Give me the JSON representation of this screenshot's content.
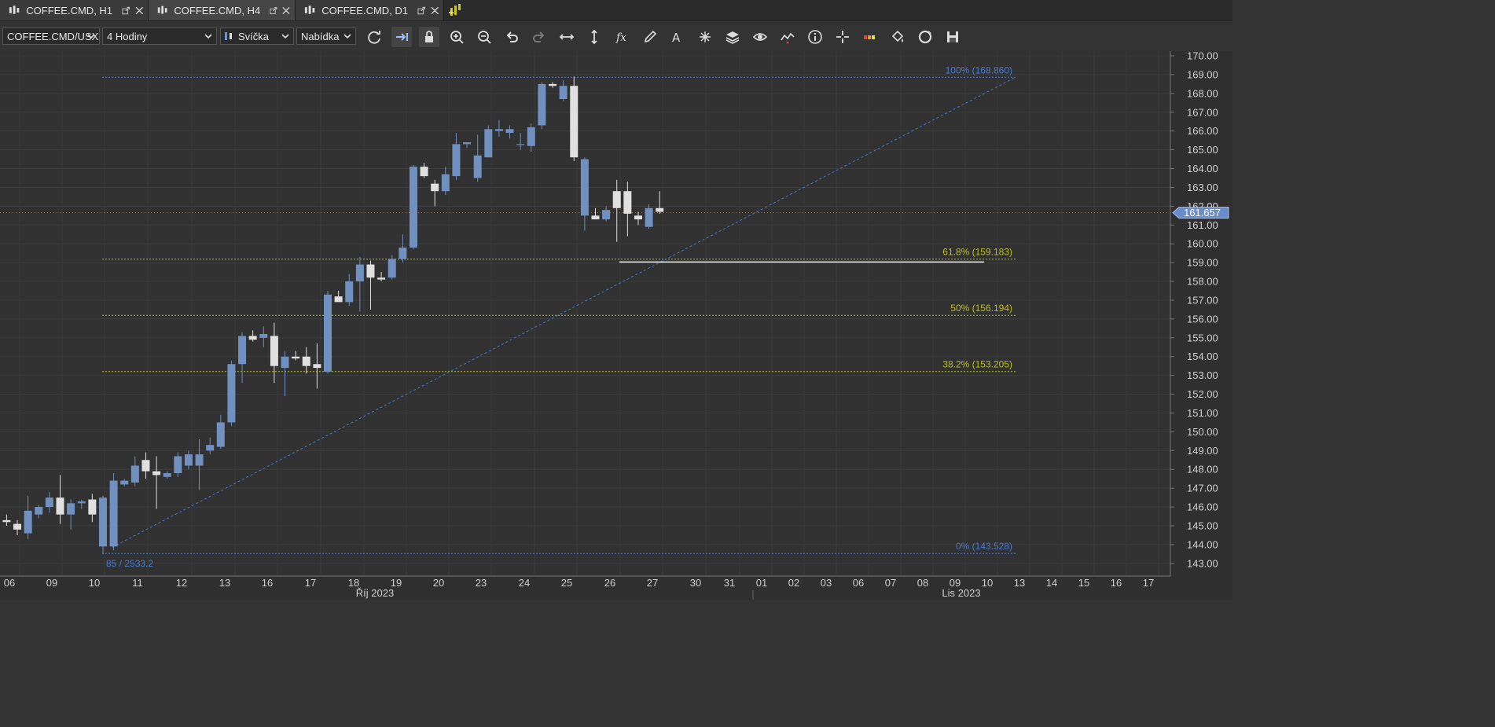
{
  "tabs": [
    {
      "label": "COFFEE.CMD, H1",
      "icon": "candlestick-icon"
    },
    {
      "label": "COFFEE.CMD, H4",
      "icon": "candlestick-icon"
    },
    {
      "label": "COFFEE.CMD, D1",
      "icon": "candlestick-icon"
    }
  ],
  "toolbar": {
    "instrument": "COFFEE.CMD/USX",
    "period": "4 Hodiny",
    "chart_type": "Svíčka",
    "price_side": "Nabídka",
    "icons": [
      "refresh-icon",
      "shift-chart-icon",
      "lock-icon",
      "zoom-in-icon",
      "zoom-out-icon",
      "undo-icon",
      "redo-icon",
      "fit-horizontal-icon",
      "fit-vertical-icon",
      "function-icon",
      "pencil-icon",
      "text-icon",
      "objects-icon",
      "layers-icon",
      "eye-icon",
      "indicator-icon",
      "info-icon",
      "crosshair-icon",
      "color-bar-icon",
      "paint-bucket-icon",
      "template-icon",
      "save-icon"
    ]
  },
  "colors": {
    "bull": "#7090c0",
    "bear": "#e0e0e0",
    "fib_level": "#b8c020",
    "fib_blue": "#4a7ad0",
    "price_tag": "#6a8cc8",
    "background": "#313131"
  },
  "chart_data": {
    "type": "candlestick",
    "ylim": [
      142.5,
      170.25
    ],
    "y_ticks": [
      "170.00",
      "169.00",
      "168.00",
      "167.00",
      "166.00",
      "165.00",
      "164.00",
      "163.00",
      "162.00",
      "161.00",
      "160.00",
      "159.00",
      "158.00",
      "157.00",
      "156.00",
      "155.00",
      "154.00",
      "153.00",
      "152.00",
      "151.00",
      "150.00",
      "149.00",
      "148.00",
      "147.00",
      "146.00",
      "145.00",
      "144.00",
      "143.00"
    ],
    "x_ticks": [
      "06",
      "09",
      "10",
      "11",
      "12",
      "13",
      "16",
      "17",
      "18",
      "19",
      "20",
      "23",
      "24",
      "25",
      "26",
      "27",
      "30",
      "31",
      "01",
      "02",
      "03",
      "06",
      "07",
      "08",
      "09",
      "10",
      "13",
      "14",
      "15",
      "16",
      "17"
    ],
    "month_labels": [
      "Říj 2023",
      "Lis 2023"
    ],
    "current_price": "161.657",
    "fibonacci": [
      {
        "label": "100% (168.860)",
        "value": 168.86
      },
      {
        "label": "61.8% (159.183)",
        "value": 159.183
      },
      {
        "label": "50% (156.194)",
        "value": 156.194
      },
      {
        "label": "38.2% (153.205)",
        "value": 153.205
      },
      {
        "label": "0% (143.528)",
        "value": 143.528
      }
    ],
    "fib_anchor_label": "85 / 2533.2",
    "horizontal_line": 159.03,
    "candles": [
      [
        145.3,
        145.6,
        145.0,
        145.2
      ],
      [
        145.1,
        145.3,
        144.5,
        144.8
      ],
      [
        144.6,
        146.6,
        144.3,
        145.8
      ],
      [
        145.6,
        146.1,
        145.4,
        146.0
      ],
      [
        146.0,
        146.8,
        145.7,
        146.5
      ],
      [
        146.5,
        147.7,
        145.1,
        145.6
      ],
      [
        145.6,
        146.4,
        144.8,
        146.2
      ],
      [
        146.2,
        146.4,
        145.9,
        146.3
      ],
      [
        146.4,
        146.7,
        145.2,
        145.6
      ],
      [
        143.9,
        146.6,
        143.5,
        146.5
      ],
      [
        143.9,
        147.8,
        143.7,
        147.4
      ],
      [
        147.2,
        147.5,
        147.1,
        147.4
      ],
      [
        147.3,
        148.7,
        147.1,
        148.2
      ],
      [
        148.5,
        148.9,
        147.5,
        147.9
      ],
      [
        147.9,
        148.7,
        145.9,
        147.7
      ],
      [
        147.6,
        147.9,
        147.5,
        147.8
      ],
      [
        147.8,
        148.9,
        147.6,
        148.7
      ],
      [
        148.2,
        149.0,
        148.0,
        148.8
      ],
      [
        148.2,
        149.6,
        146.9,
        148.8
      ],
      [
        149.0,
        149.7,
        148.8,
        149.3
      ],
      [
        149.2,
        150.9,
        149.1,
        150.5
      ],
      [
        150.5,
        153.8,
        150.3,
        153.6
      ],
      [
        153.6,
        155.3,
        152.6,
        155.1
      ],
      [
        155.1,
        155.4,
        154.8,
        154.9
      ],
      [
        155.0,
        155.6,
        154.5,
        155.2
      ],
      [
        155.1,
        155.8,
        152.6,
        153.5
      ],
      [
        153.4,
        154.3,
        151.9,
        154.0
      ],
      [
        154.0,
        154.3,
        153.8,
        153.9
      ],
      [
        154.0,
        154.5,
        153.1,
        153.5
      ],
      [
        153.6,
        154.7,
        152.3,
        153.4
      ],
      [
        153.2,
        157.5,
        153.1,
        157.3
      ],
      [
        157.2,
        157.5,
        157.0,
        156.9
      ],
      [
        156.9,
        158.4,
        156.7,
        158.0
      ],
      [
        158.0,
        159.3,
        156.4,
        158.9
      ],
      [
        158.9,
        159.1,
        156.5,
        158.2
      ],
      [
        158.2,
        158.5,
        158.0,
        158.1
      ],
      [
        158.2,
        159.4,
        158.1,
        159.2
      ],
      [
        159.2,
        160.5,
        159.0,
        159.8
      ],
      [
        159.8,
        164.2,
        159.7,
        164.1
      ],
      [
        164.1,
        164.3,
        163.5,
        163.6
      ],
      [
        163.2,
        163.4,
        162.0,
        162.8
      ],
      [
        162.8,
        164.1,
        162.6,
        163.7
      ],
      [
        163.6,
        165.9,
        163.4,
        165.3
      ],
      [
        165.3,
        165.4,
        165.1,
        165.4
      ],
      [
        163.5,
        165.8,
        163.3,
        164.7
      ],
      [
        164.6,
        166.3,
        164.6,
        166.1
      ],
      [
        166.0,
        166.6,
        165.7,
        166.1
      ],
      [
        165.9,
        166.3,
        165.6,
        166.1
      ],
      [
        165.3,
        165.9,
        165.0,
        165.3
      ],
      [
        165.2,
        166.4,
        164.9,
        166.2
      ],
      [
        166.3,
        168.6,
        166.1,
        168.5
      ],
      [
        168.5,
        168.6,
        168.3,
        168.4
      ],
      [
        167.7,
        168.7,
        167.6,
        168.4
      ],
      [
        168.4,
        168.9,
        164.4,
        164.6
      ],
      [
        161.5,
        164.6,
        160.7,
        164.5
      ],
      [
        161.5,
        161.9,
        161.3,
        161.3
      ],
      [
        161.3,
        162.0,
        161.2,
        161.8
      ],
      [
        162.8,
        163.4,
        160.1,
        161.9
      ],
      [
        162.8,
        163.3,
        160.4,
        161.6
      ],
      [
        161.5,
        161.7,
        161.0,
        161.3
      ],
      [
        160.9,
        162.1,
        160.8,
        161.9
      ],
      [
        161.9,
        162.8,
        161.6,
        161.7
      ]
    ]
  }
}
